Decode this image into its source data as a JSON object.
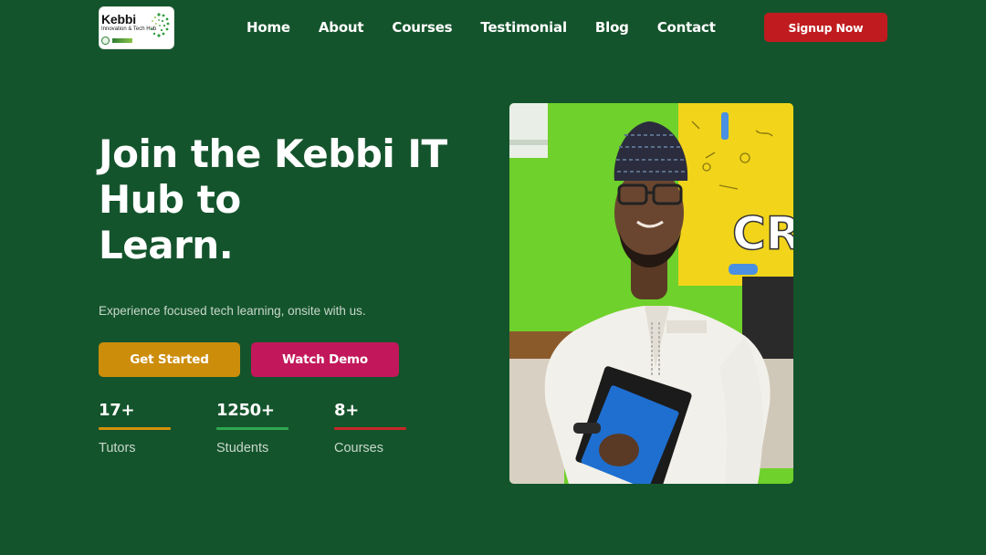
{
  "header": {
    "logo": {
      "title": "Kebbi",
      "subtitle": "Innovation & Tech Hub"
    },
    "nav": [
      {
        "label": "Home"
      },
      {
        "label": "About"
      },
      {
        "label": "Courses"
      },
      {
        "label": "Testimonial"
      },
      {
        "label": "Blog"
      },
      {
        "label": "Contact"
      }
    ],
    "signup_label": "Signup Now"
  },
  "hero": {
    "title_lines": [
      "Join the Kebbi IT",
      "Hub to",
      "Learn."
    ],
    "subtitle": "Experience focused tech learning, onsite with us.",
    "primary_button": "Get Started",
    "secondary_button": "Watch Demo",
    "stats": [
      {
        "value": "17+",
        "label": "Tutors",
        "color": "#d4900b"
      },
      {
        "value": "1250+",
        "label": "Students",
        "color": "#2fa84f"
      },
      {
        "value": "8+",
        "label": "Courses",
        "color": "#c62828"
      }
    ]
  },
  "colors": {
    "background": "#14542c",
    "signup": "#c01c1f",
    "get_started": "#cc8d0b",
    "watch_demo": "#c2185b"
  },
  "icons": {
    "logo_mark": "kebbi-logo-icon"
  }
}
